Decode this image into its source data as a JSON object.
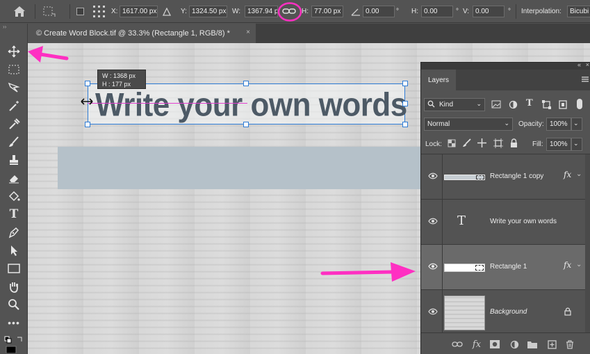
{
  "options_bar": {
    "x_label": "X:",
    "x_value": "1617.00 px",
    "y_label": "Y:",
    "y_value": "1324.50 px",
    "w_label": "W:",
    "w_value": "1367.94 p",
    "h_label": "H:",
    "h_value": "77.00 px",
    "angle_value": "0.00",
    "angle_unit": "°",
    "hskew_label": "H:",
    "hskew_value": "0.00",
    "vskew_label": "V:",
    "vskew_value": "0.00",
    "skew_unit": "°",
    "interpolation_label": "Interpolation:",
    "interpolation_value": "Bicubi"
  },
  "document_tab": {
    "title": "© Create Word Block.tif @ 33.3% (Rectangle 1, RGB/8) *",
    "close": "×"
  },
  "canvas": {
    "text": "Write your own words",
    "tooltip_w_label": "W :",
    "tooltip_w": "1368 px",
    "tooltip_h_label": "H :",
    "tooltip_h": "177 px"
  },
  "layers_panel": {
    "tab_label": "Layers",
    "filter_kind": "Kind",
    "blend_mode": "Normal",
    "opacity_label": "Opacity:",
    "opacity_value": "100%",
    "lock_label": "Lock:",
    "fill_label": "Fill:",
    "fill_value": "100%",
    "layers": [
      {
        "name": "Rectangle 1 copy",
        "fx": "fx"
      },
      {
        "name": "Write your own words",
        "thumb_glyph": "T"
      },
      {
        "name": "Rectangle 1",
        "fx": "fx",
        "selected": true
      },
      {
        "name": "Background",
        "locked": true
      }
    ]
  },
  "colors": {
    "annotation_pink": "#ff2fc2",
    "selection_blue": "#2f7cd5",
    "panel_bg": "#535353"
  }
}
